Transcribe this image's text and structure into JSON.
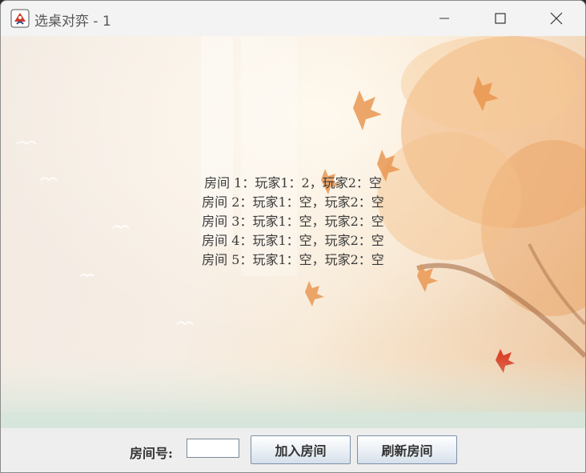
{
  "window": {
    "title": "选桌对弈 - 1",
    "icon": "java-app-icon"
  },
  "rooms": [
    {
      "text": "房间 1：玩家1：2，玩家2：空"
    },
    {
      "text": "房间 2：玩家1：空，玩家2：空"
    },
    {
      "text": "房间 3：玩家1：空，玩家2：空"
    },
    {
      "text": "房间 4：玩家1：空，玩家2：空"
    },
    {
      "text": "房间 5：玩家1：空，玩家2：空"
    }
  ],
  "bottom": {
    "room_label": "房间号:",
    "room_input_value": "",
    "join_label": "加入房间",
    "refresh_label": "刷新房间"
  }
}
